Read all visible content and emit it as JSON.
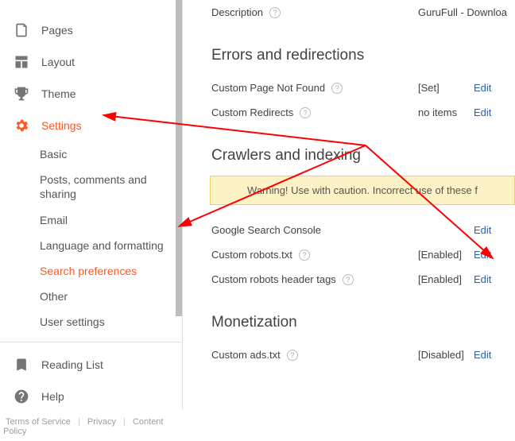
{
  "sidebar": {
    "items": [
      {
        "label": "Pages"
      },
      {
        "label": "Layout"
      },
      {
        "label": "Theme"
      },
      {
        "label": "Settings"
      }
    ],
    "settings_sub": [
      {
        "label": "Basic"
      },
      {
        "label": "Posts, comments and sharing"
      },
      {
        "label": "Email"
      },
      {
        "label": "Language and formatting"
      },
      {
        "label": "Search preferences"
      },
      {
        "label": "Other"
      },
      {
        "label": "User settings"
      }
    ],
    "bottom": [
      {
        "label": "Reading List"
      },
      {
        "label": "Help"
      }
    ]
  },
  "footer": {
    "tos": "Terms of Service",
    "privacy": "Privacy",
    "content": "Content Policy"
  },
  "main": {
    "desc_label": "Description",
    "desc_value": "GuruFull - Downloa",
    "errors_title": "Errors and redirections",
    "cpnf": "Custom Page Not Found",
    "cpnf_status": "[Set]",
    "credir": "Custom Redirects",
    "credir_status": "no items",
    "crawl_title": "Crawlers and indexing",
    "warn": "Warning! Use with caution. Incorrect use of these f",
    "gsc": "Google Search Console",
    "robots": "Custom robots.txt",
    "robots_status": "[Enabled]",
    "rheaders": "Custom robots header tags",
    "rheaders_status": "[Enabled]",
    "mon_title": "Monetization",
    "ads": "Custom ads.txt",
    "ads_status": "[Disabled]",
    "edit": "Edit"
  }
}
